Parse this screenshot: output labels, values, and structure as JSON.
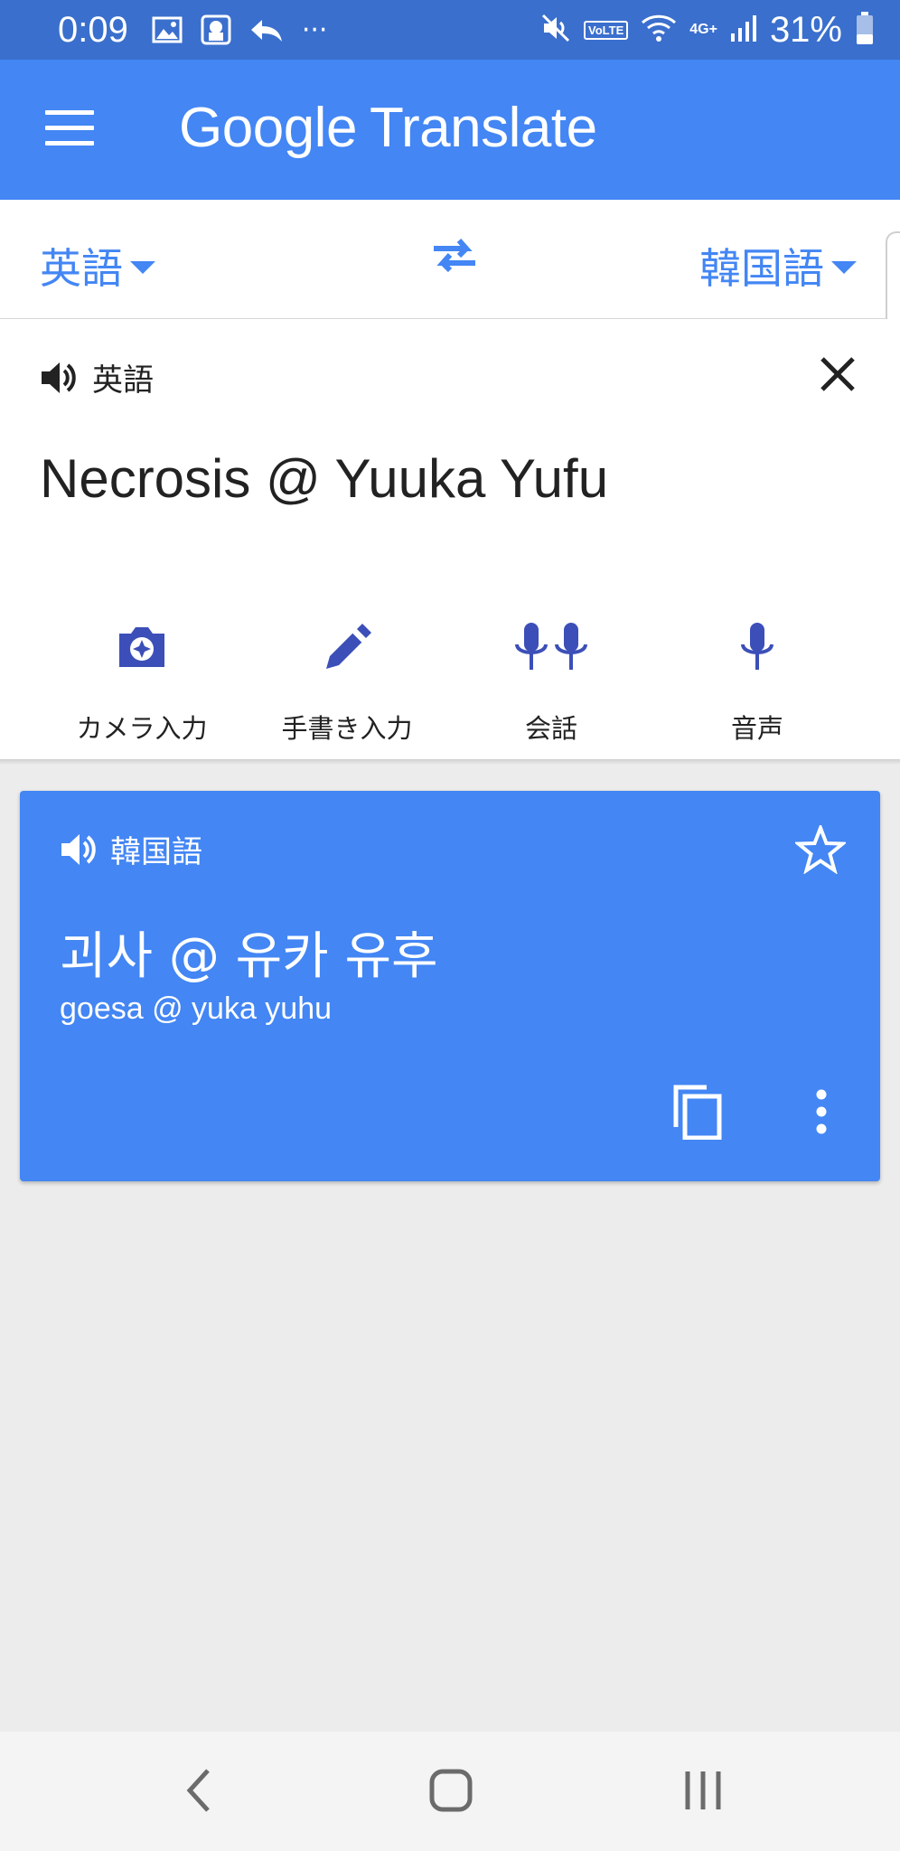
{
  "status_bar": {
    "time": "0:09",
    "icons": [
      "image-icon",
      "app-icon",
      "reply-icon",
      "more-dots-icon",
      "mute-icon",
      "volte-icon",
      "wifi-icon",
      "4g-icon",
      "signal-icon",
      "battery-icon"
    ],
    "network": "4G+",
    "volte": "VoLTE",
    "battery": "31%",
    "more": "···"
  },
  "app_bar": {
    "logo_google": "Google",
    "logo_translate": "Translate"
  },
  "language_bar": {
    "source_language": "英語",
    "target_language": "韓国語"
  },
  "input": {
    "language_label": "英語",
    "text": "Necrosis @ Yuuka Yufu"
  },
  "tools": [
    {
      "label": "カメラ入力",
      "icon": "camera-icon"
    },
    {
      "label": "手書き入力",
      "icon": "pen-icon"
    },
    {
      "label": "会話",
      "icon": "conversation-mic-icon"
    },
    {
      "label": "音声",
      "icon": "mic-icon"
    }
  ],
  "result": {
    "language_label": "韓国語",
    "translation": "괴사 @ 유카 유후",
    "transliteration": "goesa @ yuka yuhu"
  },
  "colors": {
    "status_bar": "#3a6fcd",
    "primary": "#4386f4",
    "tool_icon": "#3c4fb8",
    "background": "#ececec"
  }
}
